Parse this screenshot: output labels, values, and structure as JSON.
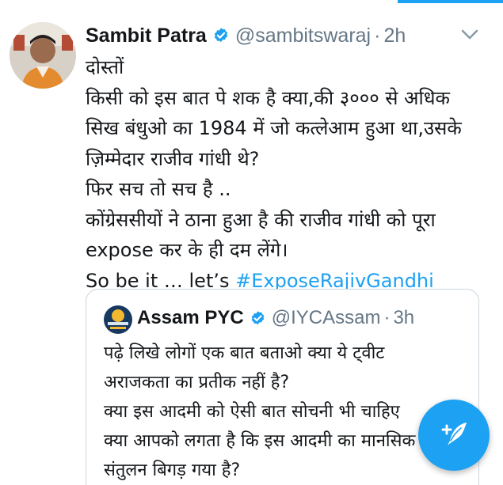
{
  "tweet": {
    "author": {
      "display_name": "Sambit Patra",
      "handle": "@sambitswaraj",
      "verified_icon": "verified-badge-icon"
    },
    "separator": "·",
    "timestamp": "2h",
    "body_lines": [
      "दोस्तों",
      "किसी को इस बात पे शक है क्या,की ३००० से अधिक",
      "सिख बंधुओ का 1984 में जो कत्लेआम हुआ था,उसके",
      "ज़िम्मेदार राजीव गांधी थे?",
      "फिर सच तो सच है ..",
      "कोंग्रेससीयों ने ठाना हुआ है की राजीव गांधी को पूरा",
      "expose कर के ही दम लेंगे।"
    ],
    "last_line_text": "So be it … let’s ",
    "hashtag": "#ExposeRajivGandhi"
  },
  "quoted_tweet": {
    "author": {
      "display_name": "Assam PYC",
      "handle": "@IYCAssam",
      "verified_icon": "verified-badge-icon"
    },
    "separator": "·",
    "timestamp": "3h",
    "body_lines": [
      "पढ़े लिखे लोगों एक बात बताओ क्या ये ट्वीट",
      "अराजकता का प्रतीक नहीं है?",
      "क्या इस आदमी को ऐसी बात सोचनी भी चाहिए",
      "क्या आपको लगता है कि इस आदमी का मानसिक",
      "संतुलन बिगड़ गया है?"
    ]
  },
  "colors": {
    "accent": "#1da1f2",
    "text": "#14171a",
    "secondary": "#657786",
    "border": "#ccd6dd"
  },
  "icons": {
    "more": "chevron-down-icon",
    "compose": "compose-tweet-icon"
  }
}
